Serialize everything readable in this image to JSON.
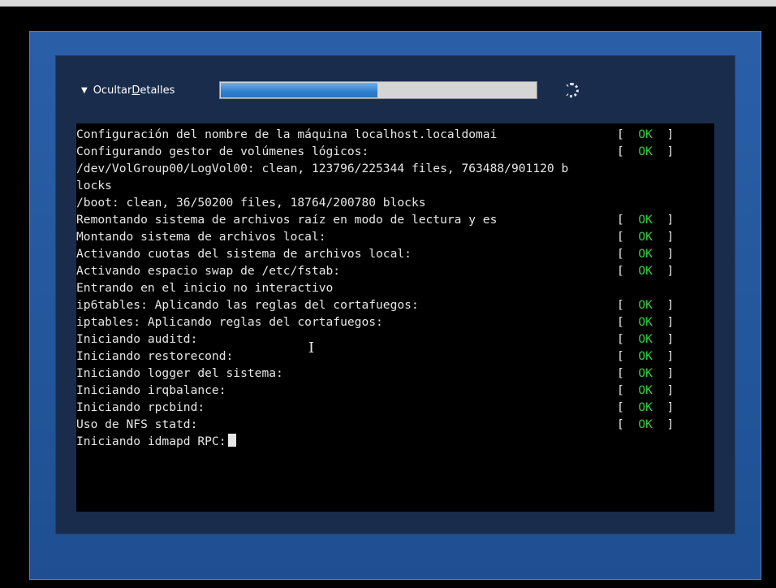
{
  "header": {
    "toggle_label_prefix": "Ocultar ",
    "toggle_label_underlined": "D",
    "toggle_label_suffix": "etalles",
    "progress_fraction": 0.5
  },
  "console": {
    "lines": [
      {
        "text": "Configuración del nombre de la máquina localhost.localdomai",
        "status": "OK"
      },
      {
        "text": "Configurando gestor de volúmenes lógicos:",
        "status": "OK"
      },
      {
        "text": "/dev/VolGroup00/LogVol00: clean, 123796/225344 files, 763488/901120 b",
        "status": ""
      },
      {
        "text": "locks",
        "status": ""
      },
      {
        "text": "/boot: clean, 36/50200 files, 18764/200780 blocks",
        "status": ""
      },
      {
        "text": "Remontando sistema de archivos raíz en modo de lectura y es",
        "status": "OK"
      },
      {
        "text": "Montando sistema de archivos local:",
        "status": "OK"
      },
      {
        "text": "Activando cuotas del sistema de archivos local:",
        "status": "OK"
      },
      {
        "text": "Activando espacio swap de /etc/fstab:",
        "status": "OK"
      },
      {
        "text": "Entrando en el inicio no interactivo",
        "status": ""
      },
      {
        "text": "ip6tables: Aplicando las reglas del cortafuegos:",
        "status": "OK"
      },
      {
        "text": "iptables: Aplicando reglas del cortafuegos:",
        "status": "OK"
      },
      {
        "text": "Iniciando auditd:",
        "status": "OK"
      },
      {
        "text": "Iniciando restorecond:",
        "status": "OK"
      },
      {
        "text": "Iniciando logger del sistema:",
        "status": "OK"
      },
      {
        "text": "Iniciando irqbalance:",
        "status": "OK"
      },
      {
        "text": "Iniciando rpcbind:",
        "status": "OK"
      },
      {
        "text": "Uso de NFS statd:",
        "status": "OK"
      },
      {
        "text": "Iniciando idmapd RPC:",
        "status": "",
        "cursor": true
      }
    ]
  },
  "colors": {
    "ok": "#31d23b",
    "frame": "#2a5fa8",
    "panel": "#192c4c"
  },
  "icons": {
    "toggle": "triangle-down-icon",
    "spinner": "loading-spinner-icon",
    "text_cursor": "ibeam-cursor-icon"
  }
}
